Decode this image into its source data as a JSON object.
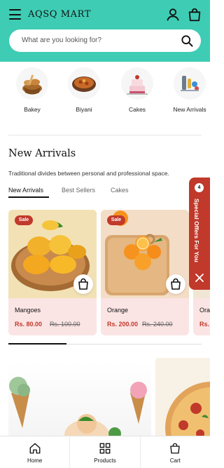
{
  "header": {
    "brand": "AQSQ MART",
    "accent_color": "#3ecdb4",
    "search_placeholder": "What are you looking for?",
    "icons": [
      "menu-icon",
      "user-icon",
      "bag-icon",
      "search-icon"
    ]
  },
  "categories": [
    {
      "label": "Bakey",
      "icon": "bread-basket-icon"
    },
    {
      "label": "Biyani",
      "icon": "biryani-bowl-icon"
    },
    {
      "label": "Cakes",
      "icon": "cake-icon"
    },
    {
      "label": "New Arrivals",
      "icon": "new-arrivals-icon"
    }
  ],
  "new_arrivals": {
    "title": "New Arrivals",
    "subtitle": "Traditional divides between personal and professional space.",
    "tabs": [
      {
        "label": "New Arrivals",
        "active": true
      },
      {
        "label": "Best Sellers",
        "active": false
      },
      {
        "label": "Cakes",
        "active": false
      }
    ],
    "products": [
      {
        "badge": "Sale",
        "name": "Mangoes",
        "price": "Rs. 80.00",
        "old_price": "Rs. 100.00"
      },
      {
        "badge": "Sale",
        "name": "Orange",
        "price": "Rs. 200.00",
        "old_price": "Rs. 240.00"
      },
      {
        "name": "Ora",
        "price": "Rs."
      }
    ],
    "scroll_progress": 0.3
  },
  "special_offers": {
    "count": "4",
    "label": "Special Offers For You",
    "color": "#c0392b"
  },
  "bottom_nav": [
    {
      "label": "Home",
      "icon": "home-icon"
    },
    {
      "label": "Products",
      "icon": "grid-icon"
    },
    {
      "label": "Cart",
      "icon": "bag-icon"
    }
  ]
}
